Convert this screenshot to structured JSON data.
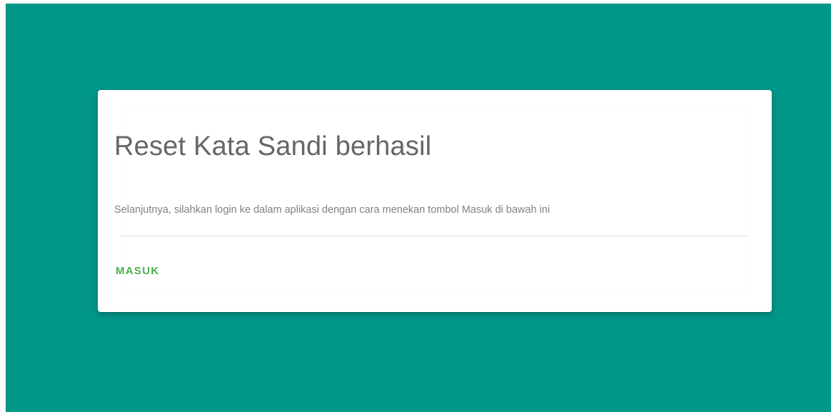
{
  "colors": {
    "background": "#009688",
    "card": "#ffffff",
    "title_text": "#666666",
    "body_text": "#808080",
    "accent": "#4caf50"
  },
  "card": {
    "title": "Reset Kata Sandi berhasil",
    "message": "Selanjutnya, silahkan login ke dalam aplikasi dengan cara menekan tombol Masuk di bawah ini",
    "actions": {
      "masuk_label": "MASUK"
    }
  }
}
